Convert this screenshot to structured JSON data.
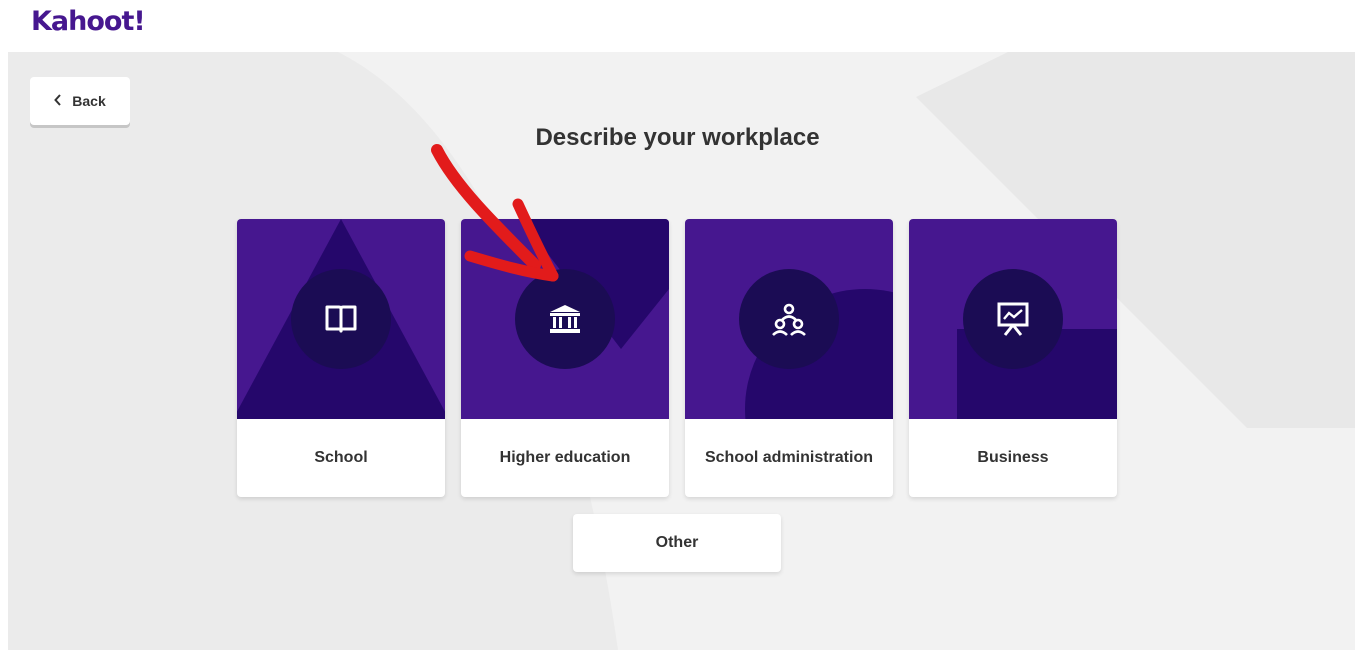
{
  "app": {
    "logo_text": "Kahoot!"
  },
  "nav": {
    "back_label": "Back"
  },
  "page": {
    "title": "Describe your workplace"
  },
  "options": [
    {
      "label": "School",
      "icon": "book-icon"
    },
    {
      "label": "Higher education",
      "icon": "building-columns-icon"
    },
    {
      "label": "School administration",
      "icon": "group-icon"
    },
    {
      "label": "Business",
      "icon": "presentation-chart-icon"
    }
  ],
  "other_option": {
    "label": "Other"
  },
  "colors": {
    "brand_purple": "#46178f",
    "dark_purple": "#25076b",
    "icon_circle": "#1b0c54",
    "annotation_arrow": "#e21b1b"
  }
}
